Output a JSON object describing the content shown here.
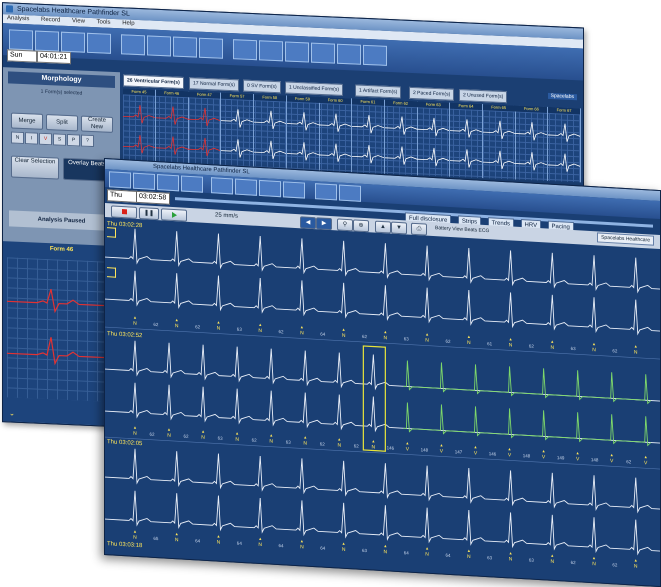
{
  "back_window": {
    "title": "Spacelabs Healthcare Pathfinder SL",
    "menu": [
      "Analysis",
      "Record",
      "View",
      "Tools",
      "Help"
    ],
    "day": "Sun",
    "time": "04:01:21",
    "morphology": {
      "heading": "Morphology",
      "selected": "1 Form(s) selected",
      "merge": "Merge",
      "split": "Split",
      "create_new": "Create New",
      "small_buttons": [
        "N",
        "I",
        "V",
        "S",
        "P",
        "?"
      ],
      "clear_selection": "Clear Selection",
      "overlay_beats": "Overlay Beats",
      "analysis": "Analysis Paused",
      "form_label": "Form 46"
    },
    "tabs": [
      "26 Ventricular Form(s)",
      "17 Normal Form(s)",
      "0 SV Form(s)",
      "1 Unclassified Form(s)",
      "1 Artifact Form(s)",
      "2 Paced Form(s)",
      "2 Unused Form(s)"
    ],
    "form_cells": [
      "Form 45",
      "Form 46",
      "Form 47",
      "Form 57",
      "Form 58",
      "Form 59",
      "Form 60",
      "Form 61",
      "Form 62",
      "Form 63",
      "Form 64",
      "Form 65",
      "Form 66",
      "Form 67"
    ]
  },
  "front_window": {
    "title": "Spacelabs Healthcare Pathfinder SL",
    "day": "Thu",
    "time": "03:02:58",
    "presets": [
      "Full disclosure",
      "Strips",
      "Trends",
      "HRV",
      "Pacing"
    ],
    "zoom": "25 mm/s",
    "status": "Battery View Beats ECG",
    "logo": "Spacelabs Healthcare",
    "strips": [
      {
        "ts": "Thu 03:02:28",
        "beats": [
          "N",
          "N",
          "N",
          "N",
          "N",
          "N",
          "N",
          "N",
          "N",
          "N",
          "N",
          "N",
          "N"
        ],
        "intervals": [
          "62",
          "62",
          "63",
          "62",
          "64",
          "62",
          "63",
          "62",
          "61",
          "62",
          "63",
          "62"
        ]
      },
      {
        "ts": "Thu 03:02:52",
        "beats": [
          "N",
          "N",
          "N",
          "N",
          "N",
          "N",
          "N",
          "N",
          "V",
          "V",
          "V",
          "V",
          "V",
          "V",
          "V",
          "V"
        ],
        "intervals": [
          "62",
          "62",
          "63",
          "62",
          "63",
          "62",
          "62",
          "146",
          "148",
          "147",
          "146",
          "148",
          "149",
          "148",
          "62"
        ]
      },
      {
        "ts": "Thu 03:02:05",
        "beats": [
          "N",
          "N",
          "N",
          "N",
          "N",
          "N",
          "N",
          "N",
          "N",
          "N",
          "N",
          "N",
          "N"
        ],
        "intervals": [
          "65",
          "64",
          "64",
          "64",
          "64",
          "63",
          "64",
          "64",
          "63",
          "63",
          "62",
          "62"
        ]
      }
    ],
    "bottom_ts": "Thu 03:03:18"
  },
  "colors": {
    "trace_normal": "#e8eef8",
    "trace_run": "#7ed96a",
    "beat_label": "#ffe65a",
    "selection_box": "#e8e43a",
    "bg": "#1a3f74"
  }
}
